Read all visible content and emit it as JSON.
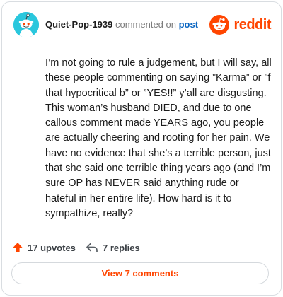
{
  "header": {
    "username": "Quiet-Pop-1939",
    "action_text": "commented on",
    "link_text": "post",
    "brand_wordmark": "reddit"
  },
  "comment": {
    "body": "I’m not going to rule a judgement, but I will say, all these people commenting on saying ”Karma” or ”f that hypocritical b” or ”YES!!” y’all are disgusting. This woman’s husband DIED, and due to one callous comment made YEARS ago, you people are actually cheering and rooting for her pain. We have no evidence that she’s a terrible person, just that she said one terrible thing years ago (and I’m sure OP has NEVER said anything rude or hateful in her entire life). How hard is it to sympathize, really?"
  },
  "footer": {
    "upvotes_label": "17 upvotes",
    "replies_label": "7 replies",
    "view_comments_label": "View 7 comments"
  },
  "icons": {
    "avatar": "snoo-avatar-icon",
    "brand": "reddit-logo-icon",
    "upvote": "upvote-arrow-icon",
    "reply": "reply-arrow-icon"
  },
  "colors": {
    "brand_orange": "#ff4500",
    "link_blue": "#0a66c2",
    "avatar_cyan": "#2ac7dd",
    "text_dark": "#1c1c1c",
    "text_muted": "#7c7c7c"
  }
}
